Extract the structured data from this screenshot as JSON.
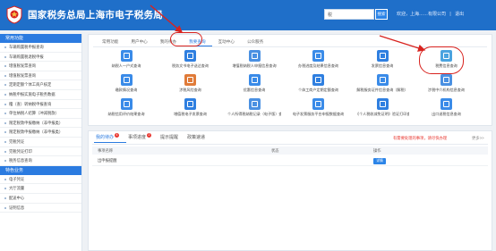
{
  "header": {
    "site_title": "国家税务总局上海市电子税务局",
    "search_placeholder": "税",
    "search_button": "搜索",
    "user_greeting": "欢迎，",
    "user_name": "上海……有限公司",
    "logout": "退出"
  },
  "sidebar": {
    "section_main": "常用功能",
    "items": [
      "车辆购置税申报查询",
      "车辆购置税退税申报",
      "增值税发票查询",
      "增值税发票查询",
      "定期定额个体工商户核定",
      "纳税申报实施电子税务数据",
      "稽（查）转纳税申报查询",
      "单位纳税人结算（冲减税款）",
      "限定税款申报缴纳（非申报类）",
      "限定税款申报缴纳（非申报类）",
      "完税凭证",
      "完税凭证打印",
      "税务信息查询"
    ],
    "section_other": "特色业务",
    "other_items": [
      "电子凭证",
      "大厅流量",
      "配送中心",
      "证明信息"
    ]
  },
  "top_tabs": [
    "常用功能",
    "用户中心",
    "我的待办",
    "我要查询",
    "互动中心",
    "公众服务"
  ],
  "active_top_tab": 3,
  "icons": [
    {
      "label": "纳税人一户式查询",
      "color": "#3a8be8"
    },
    {
      "label": "税务文书电子送达查询",
      "color": "#2f7fe0"
    },
    {
      "label": "增值税纳税人申报信息查询",
      "color": "#4a90e2"
    },
    {
      "label": "办税进度及结果信息查询",
      "color": "#3a8be8"
    },
    {
      "label": "发票信息查询",
      "color": "#2f7fe0"
    },
    {
      "label": "税费信息查询",
      "color": "#4aa3df"
    },
    {
      "label": "缴款情况查询",
      "color": "#3a8be8"
    },
    {
      "label": "涉税风险查询",
      "color": "#e07b39"
    },
    {
      "label": "优惠信息查询",
      "color": "#3a8be8"
    },
    {
      "label": "个体工商户定期定额查询",
      "color": "#2f7fe0"
    },
    {
      "label": "解税服务证件信息查询（解税）",
      "color": "#3a8be8"
    },
    {
      "label": "涉税中介机构信息查询",
      "color": "#4a90e2"
    },
    {
      "label": "纳税信用评价结果查询",
      "color": "#3a8be8"
    },
    {
      "label": "增值税电子发票查询",
      "color": "#2f7fe0"
    },
    {
      "label": "个人所得税纳税记录（电子版）查询",
      "color": "#4a90e2"
    },
    {
      "label": "电子发票服务平台申报数据查询",
      "color": "#3a8be8"
    },
    {
      "label": "《个人税收减免证明》验证打印查询",
      "color": "#2f7fe0"
    },
    {
      "label": "出口退税信息查询",
      "color": "#3a8be8"
    }
  ],
  "bottom_tabs": [
    {
      "label": "我的待办",
      "badge": "4"
    },
    {
      "label": "事项进度",
      "badge": "2"
    },
    {
      "label": "提示提醒",
      "badge": ""
    },
    {
      "label": "政策速递",
      "badge": ""
    }
  ],
  "notice": "有需要处理的事项，请尽快办理",
  "more": "更多>>",
  "table": {
    "headers": [
      "事项名称",
      "状态",
      "操作"
    ],
    "rows": [
      {
        "name": "出申报提醒",
        "status": "",
        "action": "详情"
      }
    ]
  }
}
